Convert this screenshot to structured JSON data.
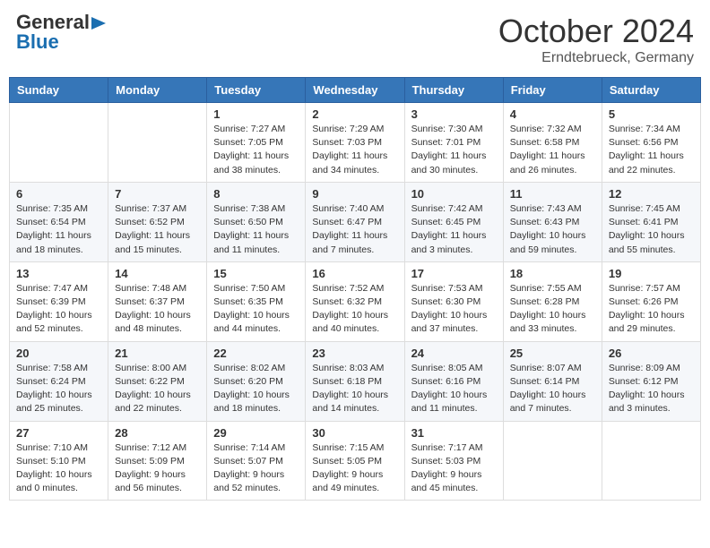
{
  "header": {
    "logo_general": "General",
    "logo_blue": "Blue",
    "month": "October 2024",
    "location": "Erndtebrueck, Germany"
  },
  "weekdays": [
    "Sunday",
    "Monday",
    "Tuesday",
    "Wednesday",
    "Thursday",
    "Friday",
    "Saturday"
  ],
  "weeks": [
    [
      {
        "day": "",
        "info": ""
      },
      {
        "day": "",
        "info": ""
      },
      {
        "day": "1",
        "info": "Sunrise: 7:27 AM\nSunset: 7:05 PM\nDaylight: 11 hours and 38 minutes."
      },
      {
        "day": "2",
        "info": "Sunrise: 7:29 AM\nSunset: 7:03 PM\nDaylight: 11 hours and 34 minutes."
      },
      {
        "day": "3",
        "info": "Sunrise: 7:30 AM\nSunset: 7:01 PM\nDaylight: 11 hours and 30 minutes."
      },
      {
        "day": "4",
        "info": "Sunrise: 7:32 AM\nSunset: 6:58 PM\nDaylight: 11 hours and 26 minutes."
      },
      {
        "day": "5",
        "info": "Sunrise: 7:34 AM\nSunset: 6:56 PM\nDaylight: 11 hours and 22 minutes."
      }
    ],
    [
      {
        "day": "6",
        "info": "Sunrise: 7:35 AM\nSunset: 6:54 PM\nDaylight: 11 hours and 18 minutes."
      },
      {
        "day": "7",
        "info": "Sunrise: 7:37 AM\nSunset: 6:52 PM\nDaylight: 11 hours and 15 minutes."
      },
      {
        "day": "8",
        "info": "Sunrise: 7:38 AM\nSunset: 6:50 PM\nDaylight: 11 hours and 11 minutes."
      },
      {
        "day": "9",
        "info": "Sunrise: 7:40 AM\nSunset: 6:47 PM\nDaylight: 11 hours and 7 minutes."
      },
      {
        "day": "10",
        "info": "Sunrise: 7:42 AM\nSunset: 6:45 PM\nDaylight: 11 hours and 3 minutes."
      },
      {
        "day": "11",
        "info": "Sunrise: 7:43 AM\nSunset: 6:43 PM\nDaylight: 10 hours and 59 minutes."
      },
      {
        "day": "12",
        "info": "Sunrise: 7:45 AM\nSunset: 6:41 PM\nDaylight: 10 hours and 55 minutes."
      }
    ],
    [
      {
        "day": "13",
        "info": "Sunrise: 7:47 AM\nSunset: 6:39 PM\nDaylight: 10 hours and 52 minutes."
      },
      {
        "day": "14",
        "info": "Sunrise: 7:48 AM\nSunset: 6:37 PM\nDaylight: 10 hours and 48 minutes."
      },
      {
        "day": "15",
        "info": "Sunrise: 7:50 AM\nSunset: 6:35 PM\nDaylight: 10 hours and 44 minutes."
      },
      {
        "day": "16",
        "info": "Sunrise: 7:52 AM\nSunset: 6:32 PM\nDaylight: 10 hours and 40 minutes."
      },
      {
        "day": "17",
        "info": "Sunrise: 7:53 AM\nSunset: 6:30 PM\nDaylight: 10 hours and 37 minutes."
      },
      {
        "day": "18",
        "info": "Sunrise: 7:55 AM\nSunset: 6:28 PM\nDaylight: 10 hours and 33 minutes."
      },
      {
        "day": "19",
        "info": "Sunrise: 7:57 AM\nSunset: 6:26 PM\nDaylight: 10 hours and 29 minutes."
      }
    ],
    [
      {
        "day": "20",
        "info": "Sunrise: 7:58 AM\nSunset: 6:24 PM\nDaylight: 10 hours and 25 minutes."
      },
      {
        "day": "21",
        "info": "Sunrise: 8:00 AM\nSunset: 6:22 PM\nDaylight: 10 hours and 22 minutes."
      },
      {
        "day": "22",
        "info": "Sunrise: 8:02 AM\nSunset: 6:20 PM\nDaylight: 10 hours and 18 minutes."
      },
      {
        "day": "23",
        "info": "Sunrise: 8:03 AM\nSunset: 6:18 PM\nDaylight: 10 hours and 14 minutes."
      },
      {
        "day": "24",
        "info": "Sunrise: 8:05 AM\nSunset: 6:16 PM\nDaylight: 10 hours and 11 minutes."
      },
      {
        "day": "25",
        "info": "Sunrise: 8:07 AM\nSunset: 6:14 PM\nDaylight: 10 hours and 7 minutes."
      },
      {
        "day": "26",
        "info": "Sunrise: 8:09 AM\nSunset: 6:12 PM\nDaylight: 10 hours and 3 minutes."
      }
    ],
    [
      {
        "day": "27",
        "info": "Sunrise: 7:10 AM\nSunset: 5:10 PM\nDaylight: 10 hours and 0 minutes."
      },
      {
        "day": "28",
        "info": "Sunrise: 7:12 AM\nSunset: 5:09 PM\nDaylight: 9 hours and 56 minutes."
      },
      {
        "day": "29",
        "info": "Sunrise: 7:14 AM\nSunset: 5:07 PM\nDaylight: 9 hours and 52 minutes."
      },
      {
        "day": "30",
        "info": "Sunrise: 7:15 AM\nSunset: 5:05 PM\nDaylight: 9 hours and 49 minutes."
      },
      {
        "day": "31",
        "info": "Sunrise: 7:17 AM\nSunset: 5:03 PM\nDaylight: 9 hours and 45 minutes."
      },
      {
        "day": "",
        "info": ""
      },
      {
        "day": "",
        "info": ""
      }
    ]
  ]
}
